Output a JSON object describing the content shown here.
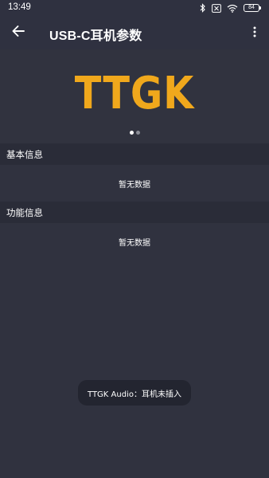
{
  "status_bar": {
    "time": "13:49",
    "battery_level": "84",
    "icons": [
      "bluetooth-icon",
      "no-sim-icon",
      "wifi-icon",
      "battery-icon"
    ]
  },
  "app_bar": {
    "back_icon": "arrow-left-icon",
    "title": "USB-C耳机参数",
    "more_icon": "more-vertical-icon"
  },
  "banner": {
    "logo_text": "TTGK",
    "logo_color": "#f0a81c",
    "page_count": 2,
    "active_page": 1
  },
  "sections": [
    {
      "title": "基本信息",
      "empty_text": "暂无数据"
    },
    {
      "title": "功能信息",
      "empty_text": "暂无数据"
    }
  ],
  "toast": {
    "message": "TTGK Audio：耳机未插入"
  },
  "colors": {
    "background": "#30323f",
    "section_header": "#2a2c38",
    "accent": "#f0a81c"
  }
}
